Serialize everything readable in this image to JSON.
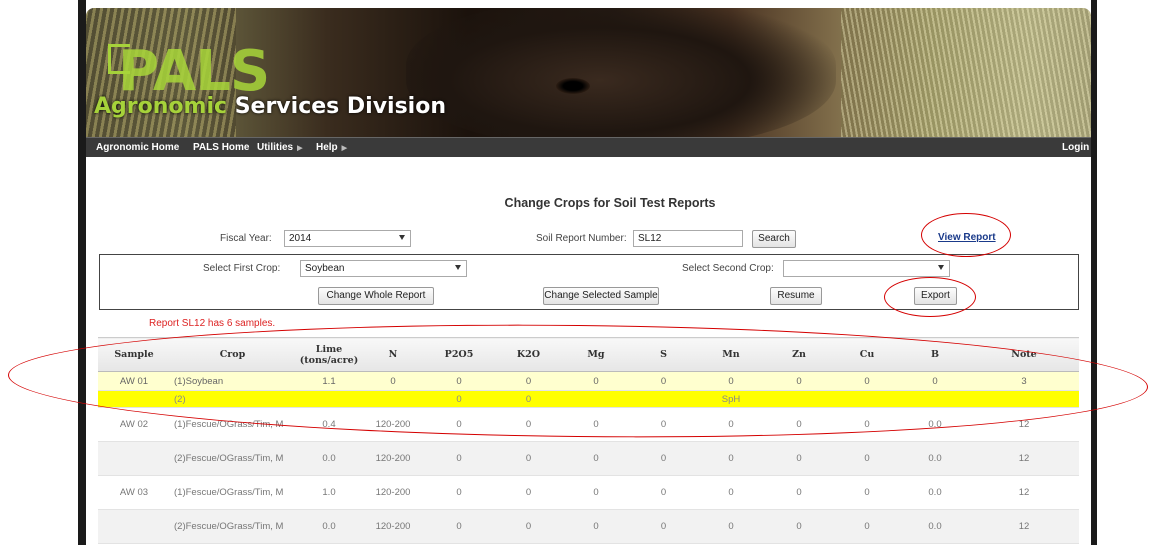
{
  "banner": {
    "logo_text": "PALS",
    "division_first": "Agronomic",
    "division_rest": " Services Division"
  },
  "nav": {
    "items": [
      "Agronomic Home",
      "PALS Home",
      "Utilities",
      "Help"
    ],
    "login": "Login"
  },
  "heading": "Change Crops for Soil Test Reports",
  "filters": {
    "fiscal_year_label": "Fiscal Year:",
    "fiscal_year_value": "2014",
    "report_number_label": "Soil Report Number:",
    "report_number_value": "SL12",
    "search_button": "Search",
    "view_report_link": "View Report"
  },
  "crop_select": {
    "first_label": "Select First Crop:",
    "first_value": "Soybean",
    "second_label": "Select Second Crop:",
    "second_value": "",
    "buttons": {
      "change_whole": "Change Whole Report",
      "change_selected": "Change Selected Sample",
      "resume": "Resume",
      "export": "Export"
    }
  },
  "status_message": "Report SL12 has 6 samples.",
  "table": {
    "columns": [
      "Sample",
      "Crop",
      "Lime (tons/acre)",
      "N",
      "P2O5",
      "K2O",
      "Mg",
      "S",
      "Mn",
      "Zn",
      "Cu",
      "B",
      "Note"
    ],
    "rows": [
      [
        "AW 01",
        "(1)Soybean",
        "1.1",
        "0",
        "0",
        "0",
        "0",
        "0",
        "0",
        "0",
        "0",
        "0",
        "3"
      ],
      [
        "",
        "(2)",
        "",
        "",
        "0",
        "0",
        "",
        "",
        "SpH",
        "",
        "",
        "",
        ""
      ],
      [
        "AW 02",
        "(1)Fescue/OGrass/Tim, M",
        "0.4",
        "120-200",
        "0",
        "0",
        "0",
        "0",
        "0",
        "0",
        "0",
        "0.0",
        "12"
      ],
      [
        "",
        "(2)Fescue/OGrass/Tim, M",
        "0.0",
        "120-200",
        "0",
        "0",
        "0",
        "0",
        "0",
        "0",
        "0",
        "0.0",
        "12"
      ],
      [
        "AW 03",
        "(1)Fescue/OGrass/Tim, M",
        "1.0",
        "120-200",
        "0",
        "0",
        "0",
        "0",
        "0",
        "0",
        "0",
        "0.0",
        "12"
      ],
      [
        "",
        "(2)Fescue/OGrass/Tim, M",
        "0.0",
        "120-200",
        "0",
        "0",
        "0",
        "0",
        "0",
        "0",
        "0",
        "0.0",
        "12"
      ]
    ]
  },
  "colors": {
    "highlight_row": "#ffff00",
    "selected_row": "#ffffcf",
    "annotation": "#d40000",
    "status_text": "#d22222"
  }
}
